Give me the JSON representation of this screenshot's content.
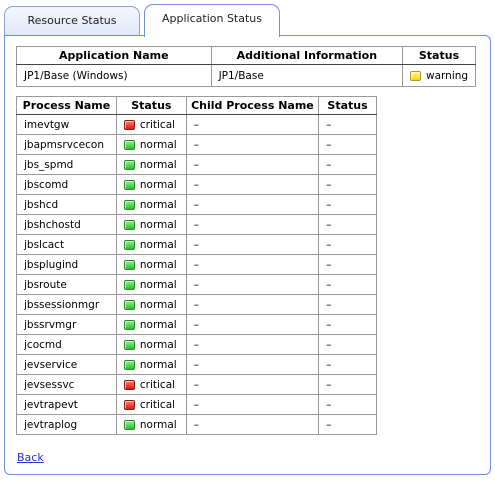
{
  "tabs": [
    {
      "label": "Resource Status"
    },
    {
      "label": "Application Status"
    }
  ],
  "app_table": {
    "headers": [
      "Application Name",
      "Additional Information",
      "Status"
    ],
    "row": {
      "name": "JP1/Base (Windows)",
      "info": "JP1/Base",
      "status": "warning"
    }
  },
  "process_table": {
    "headers": [
      "Process Name",
      "Status",
      "Child Process Name",
      "Status"
    ],
    "rows": [
      {
        "name": "imevtgw",
        "status": "critical",
        "child": "–",
        "child_status": "–"
      },
      {
        "name": "jbapmsrvcecon",
        "status": "normal",
        "child": "–",
        "child_status": "–"
      },
      {
        "name": "jbs_spmd",
        "status": "normal",
        "child": "–",
        "child_status": "–"
      },
      {
        "name": "jbscomd",
        "status": "normal",
        "child": "–",
        "child_status": "–"
      },
      {
        "name": "jbshcd",
        "status": "normal",
        "child": "–",
        "child_status": "–"
      },
      {
        "name": "jbshchostd",
        "status": "normal",
        "child": "–",
        "child_status": "–"
      },
      {
        "name": "jbslcact",
        "status": "normal",
        "child": "–",
        "child_status": "–"
      },
      {
        "name": "jbsplugind",
        "status": "normal",
        "child": "–",
        "child_status": "–"
      },
      {
        "name": "jbsroute",
        "status": "normal",
        "child": "–",
        "child_status": "–"
      },
      {
        "name": "jbssessionmgr",
        "status": "normal",
        "child": "–",
        "child_status": "–"
      },
      {
        "name": "jbssrvmgr",
        "status": "normal",
        "child": "–",
        "child_status": "–"
      },
      {
        "name": "jcocmd",
        "status": "normal",
        "child": "–",
        "child_status": "–"
      },
      {
        "name": "jevservice",
        "status": "normal",
        "child": "–",
        "child_status": "–"
      },
      {
        "name": "jevsessvc",
        "status": "critical",
        "child": "–",
        "child_status": "–"
      },
      {
        "name": "jevtrapevt",
        "status": "critical",
        "child": "–",
        "child_status": "–"
      },
      {
        "name": "jevtraplog",
        "status": "normal",
        "child": "–",
        "child_status": "–"
      }
    ]
  },
  "back_label": "Back"
}
